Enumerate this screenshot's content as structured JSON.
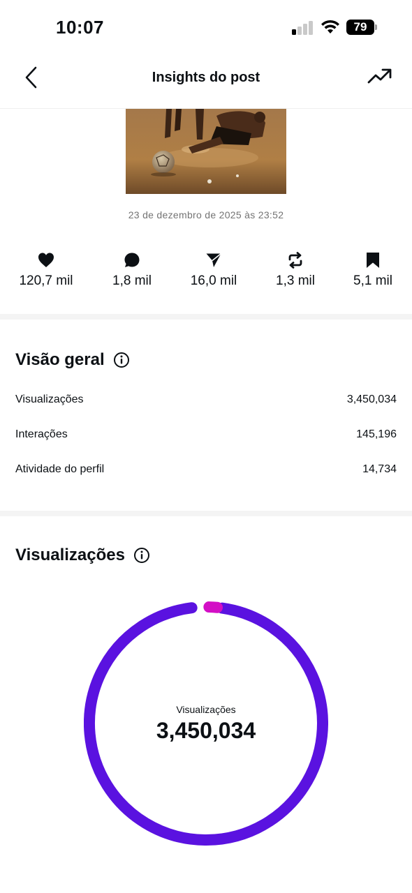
{
  "status_bar": {
    "time": "10:07",
    "battery": "79"
  },
  "header": {
    "title": "Insights do post"
  },
  "post": {
    "date": "23 de dezembro de 2025 às 23:52"
  },
  "metrics": [
    {
      "icon": "heart-icon",
      "value": "120,7 mil"
    },
    {
      "icon": "comment-icon",
      "value": "1,8 mil"
    },
    {
      "icon": "share-icon",
      "value": "16,0 mil"
    },
    {
      "icon": "repost-icon",
      "value": "1,3 mil"
    },
    {
      "icon": "bookmark-icon",
      "value": "5,1 mil"
    }
  ],
  "overview": {
    "title": "Visão geral",
    "rows": [
      {
        "label": "Visualizações",
        "value": "3,450,034"
      },
      {
        "label": "Interações",
        "value": "145,196"
      },
      {
        "label": "Atividade do perfil",
        "value": "14,734"
      }
    ]
  },
  "views": {
    "title": "Visualizações",
    "center_label": "Visualizações",
    "center_value": "3,450,034"
  },
  "colors": {
    "donut_main": "#5a12e0",
    "donut_accent": "#d30fc5"
  }
}
